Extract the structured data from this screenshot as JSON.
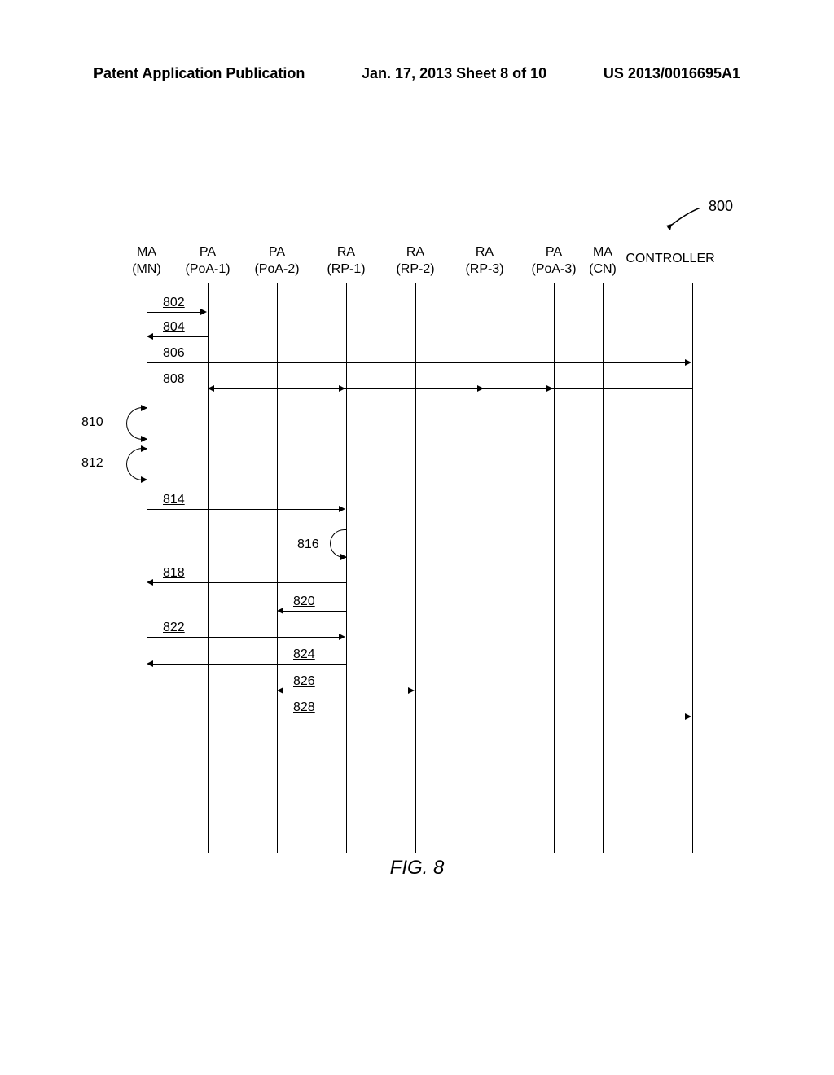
{
  "header": {
    "left": "Patent Application Publication",
    "center": "Jan. 17, 2013  Sheet 8 of 10",
    "right": "US 2013/0016695A1"
  },
  "diagram": {
    "ref_number": "800",
    "lanes": [
      {
        "top": "MA",
        "bottom": "(MN)"
      },
      {
        "top": "PA",
        "bottom": "(PoA-1)"
      },
      {
        "top": "PA",
        "bottom": "(PoA-2)"
      },
      {
        "top": "RA",
        "bottom": "(RP-1)"
      },
      {
        "top": "RA",
        "bottom": "(RP-2)"
      },
      {
        "top": "RA",
        "bottom": "(RP-3)"
      },
      {
        "top": "PA",
        "bottom": "(PoA-3)"
      },
      {
        "top": "MA",
        "bottom": "(CN)"
      },
      {
        "top": "CONTROLLER",
        "bottom": ""
      }
    ],
    "messages": {
      "m802": "802",
      "m804": "804",
      "m806": "806",
      "m808": "808",
      "m810": "810",
      "m812": "812",
      "m814": "814",
      "m816": "816",
      "m818": "818",
      "m820": "820",
      "m822": "822",
      "m824": "824",
      "m826": "826",
      "m828": "828"
    },
    "caption": "FIG. 8"
  }
}
